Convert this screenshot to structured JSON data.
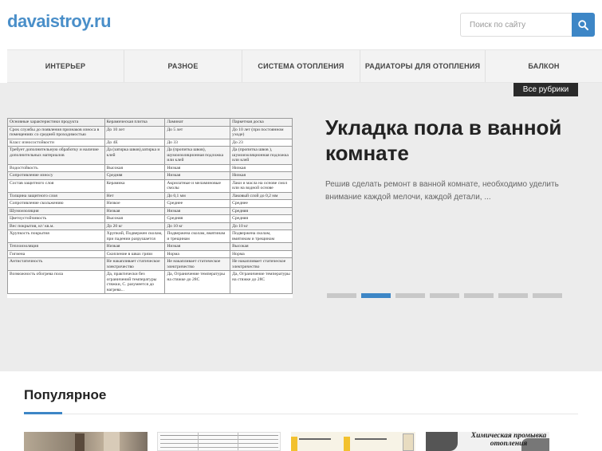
{
  "site": {
    "logo": "davaistroy.ru"
  },
  "search": {
    "placeholder": "Поиск по сайту"
  },
  "nav": {
    "items": [
      {
        "label": "ИНТЕРЬЕР"
      },
      {
        "label": "РАЗНОЕ"
      },
      {
        "label": "СИСТЕМА ОТОПЛЕНИЯ"
      },
      {
        "label": "РАДИАТОРЫ ДЛЯ ОТОПЛЕНИЯ"
      },
      {
        "label": "БАЛКОН"
      }
    ]
  },
  "slider": {
    "all_rubrics": "Все рубрики",
    "title": "Укладка пола в ванной комнате",
    "excerpt": "Решив сделать ремонт в ванной комнате, необходимо уделить внимание каждой мелочи, каждой детали, ...",
    "dot_count": 7,
    "active_dot": 1,
    "table": {
      "header": [
        "Основные характеристики продукта",
        "Керамическая плитка",
        "Ламинат",
        "Паркетная доска"
      ],
      "rows": [
        [
          "Срок службы до появления признаков износа в помещениях со средней проходимостью",
          "До 10 лет",
          "До 5 лет",
          "До 10 лет (при постоянном уходе)"
        ],
        [
          "Класс износостойкости",
          "До 4Е",
          "До 33",
          "До 23"
        ],
        [
          "Требует дополнительную обработку и наличие дополнительных материалов",
          "Да (затирка швов),затирка и клей",
          "Да (пропитка швов), шумоизоляционная подложка или клей",
          "Да (пропитка швов ), шумоизоляционная подложка или клей"
        ],
        [
          "Водостойкость",
          "Высокая",
          "Низкая",
          "Низкая"
        ],
        [
          "Сопротивление износу",
          "Средняя",
          "Низкая",
          "Низкая"
        ],
        [
          "Состав защитного слоя",
          "Керамика",
          "Акрилатные и меламиновые смолы",
          "Лаки и масла на основе смол или на водной основе"
        ],
        [
          "Толщина защитного слоя",
          "Нет",
          "До 0,1 мм",
          "Лаковый слой до 0,2 мм"
        ],
        [
          "Сопротивление скольжению",
          "Низкое",
          "Среднее",
          "Среднее"
        ],
        [
          "Шумоизоляция",
          "Низкая",
          "Низкая",
          "Средняя"
        ],
        [
          "Цветоустойчивость",
          "Высокая",
          "Средняя",
          "Средняя"
        ],
        [
          "Вес покрытия, кг/ кв.м.",
          "До 20 кг",
          "До 10 кг",
          "До 10 кг"
        ],
        [
          "Хрупкость покрытия",
          "Хрупкий, Подвержен сколам, при падении разрушается",
          "Подвержена сколам, вмятинам и трещинам",
          "Подвержена сколам, вмятинам и трещинам"
        ],
        [
          "Теплоизоляция",
          "Низкая",
          "Низкая",
          "Высокая"
        ],
        [
          "Гигиена",
          "Скопление в швах грязи",
          "Норма",
          "Норма"
        ],
        [
          "Антистатичность",
          "Не накапливает статическое электричество",
          "Не накапливает статическое электричество",
          "Не накапливает статическое электричество"
        ],
        [
          "Возможность обогрева пола",
          "Да, практически без ограничений температуры стяжки, С. разумеется до нагрева...",
          "Да, Ограничение температуры на стяжке до 28С",
          "Да, Ограничение температуры на стяжке до 28С"
        ]
      ]
    }
  },
  "popular": {
    "title": "Популярное",
    "thumbs": [
      {
        "name": "bathroom-floor"
      },
      {
        "name": "table-doc"
      },
      {
        "name": "yellow-doc"
      },
      {
        "name": "heating-flush",
        "caption": "Химическая промывка отопления"
      }
    ]
  },
  "colors": {
    "accent": "#3d86c6",
    "logo": "#4a8fc9",
    "slider_bg": "#ececec"
  }
}
